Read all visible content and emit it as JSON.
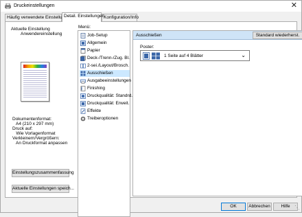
{
  "window": {
    "title": "Druckeinstellungen",
    "close_glyph": "✕"
  },
  "tabs": [
    {
      "label": "Häufig verwendete Einstellungen",
      "active": false
    },
    {
      "label": "Detail. Einstellungen",
      "active": true
    },
    {
      "label": "Konfiguration/Info",
      "active": false
    }
  ],
  "left": {
    "current_label": "Aktuelle Einstellung",
    "current_name": "Anwendereinstellung",
    "info_lines": [
      "Dokumentenformat:",
      "   A4 (210 x 297 mm)",
      "Druck auf:",
      "   Wie Vorlagenformat",
      "Verkleinern/Vergrößern:",
      "   An Druckformat anpassen"
    ],
    "summary_button": "Einstellungszusammenfassung",
    "save_button": "Aktuelle Einstellungen speich..."
  },
  "menu": {
    "label": "Menü:",
    "items": [
      {
        "label": "Job-Setup",
        "icon": "job-setup-icon",
        "selected": false
      },
      {
        "label": "Allgemein",
        "icon": "general-icon",
        "selected": false
      },
      {
        "label": "Papier",
        "icon": "paper-icon",
        "selected": false
      },
      {
        "label": "Deck-/Trenn-/Zug. Bl.",
        "icon": "cover-sheet-icon",
        "selected": false
      },
      {
        "label": "2-sei./Layout/Brosch.",
        "icon": "layout-icon",
        "selected": false
      },
      {
        "label": "Ausschießen",
        "icon": "imposition-icon",
        "selected": true
      },
      {
        "label": "Ausgabeeinstellungen",
        "icon": "output-icon",
        "selected": false
      },
      {
        "label": "Finishing",
        "icon": "finishing-icon",
        "selected": false
      },
      {
        "label": "Druckqualität: Standrd.",
        "icon": "print-quality-icon",
        "selected": false
      },
      {
        "label": "Druckqualität: Erweit.",
        "icon": "print-quality-advanced-icon",
        "selected": false
      },
      {
        "label": "Effekte",
        "icon": "effects-icon",
        "selected": false
      },
      {
        "label": "Treiberoptionen",
        "icon": "driver-options-icon",
        "selected": false
      }
    ]
  },
  "panel": {
    "header": "Ausschießen",
    "restore_button": "Standard wiederherst.",
    "poster_label": "Poster:",
    "poster_value": "1 Seite auf 4 Blätter",
    "poster_icon": "poster-4-sheets-icon"
  },
  "footer": {
    "ok": "OK",
    "cancel": "Abbrechen",
    "help": "Hilfe"
  },
  "colors": {
    "selected_item": "#cce8ff",
    "panel_header": "#cfe4f7",
    "button_face": "#e1e1e1",
    "accent": "#0078d7"
  }
}
